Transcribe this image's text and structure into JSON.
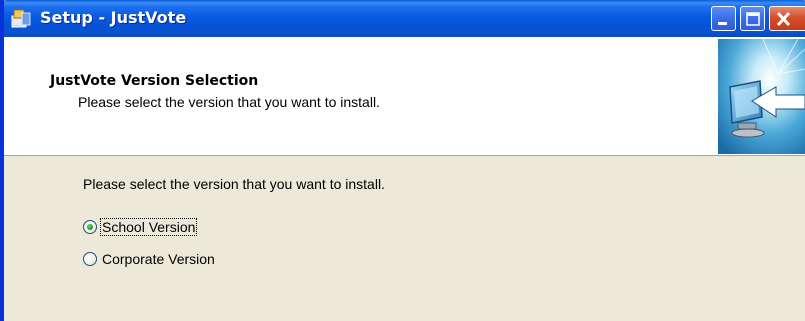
{
  "window": {
    "title": "Setup - JustVote",
    "icon": "setup-installer-icon"
  },
  "titlebar_buttons": {
    "minimize": "minimize-icon",
    "maximize": "maximize-icon",
    "close": "close-icon"
  },
  "header": {
    "title": "JustVote Version Selection",
    "subtitle": "Please select the version that you want to install.",
    "image": "install-computer-arrow-icon"
  },
  "body": {
    "prompt": "Please select the version that you want to install.",
    "options": [
      {
        "label": "School Version",
        "selected": true
      },
      {
        "label": "Corporate Version",
        "selected": false
      }
    ]
  },
  "colors": {
    "titlebar_blue": "#0a5ae0",
    "window_face": "#ece9d8",
    "close_red": "#d4502e",
    "radio_green": "#21a121"
  }
}
